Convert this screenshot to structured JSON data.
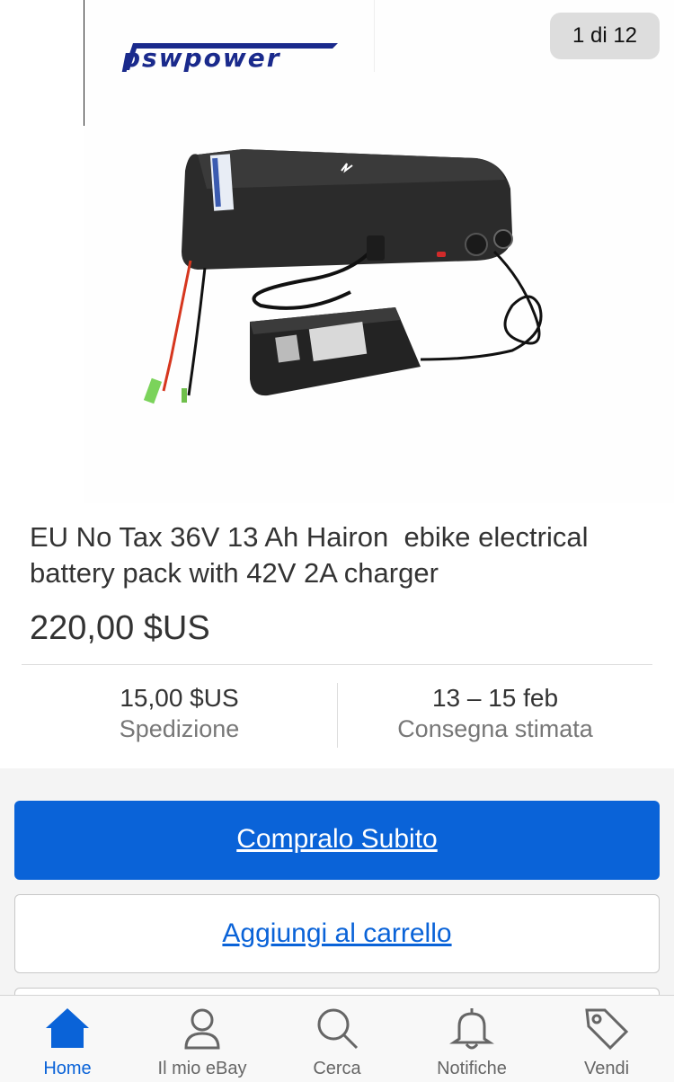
{
  "gallery": {
    "brand_logo": "pswpower",
    "counter": "1 di 12"
  },
  "product": {
    "title": "EU No Tax 36V 13 Ah Hairon  ebike electrical battery pack with 42V 2A charger",
    "price": "220,00 $US"
  },
  "shipping": {
    "value": "15,00 $US",
    "label": "Spedizione"
  },
  "delivery": {
    "value": "13 – 15 feb",
    "label": "Consegna stimata"
  },
  "actions": {
    "buy_now": "Compralo Subito",
    "add_to_cart": "Aggiungi al carrello"
  },
  "tabbar": {
    "items": [
      {
        "label": "Home",
        "icon": "home-icon",
        "active": true
      },
      {
        "label": "Il mio eBay",
        "icon": "person-icon",
        "active": false
      },
      {
        "label": "Cerca",
        "icon": "search-icon",
        "active": false
      },
      {
        "label": "Notifiche",
        "icon": "bell-icon",
        "active": false
      },
      {
        "label": "Vendi",
        "icon": "tag-icon",
        "active": false
      }
    ]
  },
  "colors": {
    "accent": "#0a63d8",
    "text": "#333333",
    "muted": "#777777",
    "badge_bg": "#dddddd",
    "logo": "#1a2a8c"
  }
}
